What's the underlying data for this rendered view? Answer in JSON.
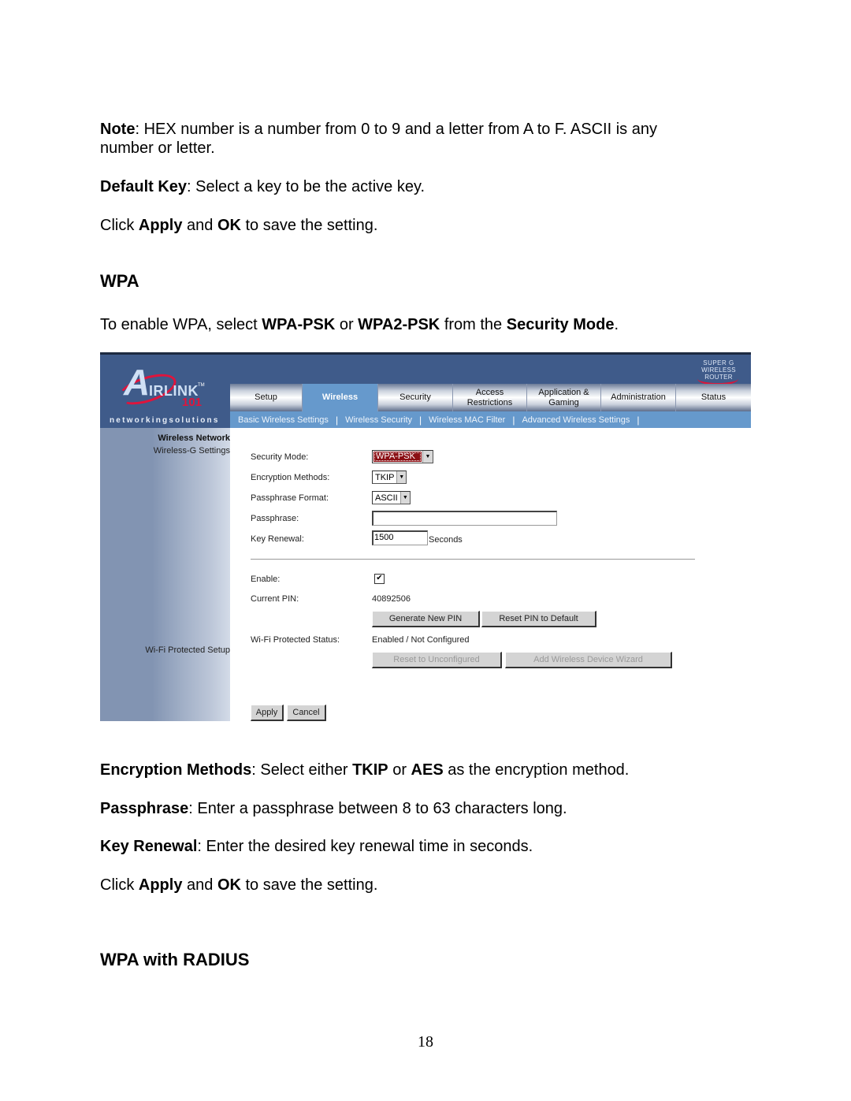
{
  "doc": {
    "note": {
      "bold": "Note",
      "rest": ": HEX number is a number from 0 to 9 and a letter from A to F. ASCII is any number or letter."
    },
    "default_key": {
      "bold": "Default Key",
      "rest": ": Select a key to be the active key."
    },
    "click_apply_1": {
      "pre": "Click ",
      "b1": "Apply",
      "mid": " and ",
      "b2": "OK",
      "post": " to save the setting."
    },
    "wpa_heading": "WPA",
    "wpa_intro": {
      "pre": "To enable WPA, select ",
      "b1": "WPA-PSK",
      "mid": " or ",
      "b2": "WPA2-PSK",
      "mid2": " from the ",
      "b3": "Security Mode",
      "post": "."
    },
    "encryption": {
      "bold": "Encryption Methods",
      "mid": ": Select either ",
      "b1": "TKIP",
      "mid2": " or ",
      "b2": "AES",
      "post": " as the encryption method."
    },
    "passphrase": {
      "bold": "Passphrase",
      "rest": ": Enter a passphrase between 8 to 63 characters long."
    },
    "key_renewal": {
      "bold": "Key Renewal",
      "rest": ": Enter the desired key renewal time in seconds."
    },
    "click_apply_2": {
      "pre": "Click ",
      "b1": "Apply",
      "mid": " and ",
      "b2": "OK",
      "post": " to save the setting."
    },
    "radius_heading": "WPA with RADIUS",
    "page_number": "18"
  },
  "router": {
    "logo": {
      "letter": "A",
      "brand": "IRLINK",
      "tm": "TM",
      "number": "101",
      "tagline": "networkingsolutions"
    },
    "badge": {
      "line1": "SUPER G",
      "line2": "WIRELESS ROUTER"
    },
    "tabs": [
      {
        "label": "Setup",
        "active": false
      },
      {
        "label": "Wireless",
        "active": true
      },
      {
        "label": "Security",
        "active": false
      },
      {
        "label": "Access Restrictions",
        "active": false
      },
      {
        "label": "Application & Gaming",
        "active": false
      },
      {
        "label": "Administration",
        "active": false
      },
      {
        "label": "Status",
        "active": false
      }
    ],
    "subnav": [
      "Basic Wireless Settings",
      "Wireless Security",
      "Wireless MAC Filter",
      "Advanced Wireless Settings"
    ],
    "sidebar": {
      "title": "Wireless Network",
      "sub": "Wireless-G Settings",
      "wps": "Wi-Fi Protected Setup"
    },
    "form": {
      "security_mode": {
        "label": "Security Mode:",
        "value": "WPA-PSK"
      },
      "encryption": {
        "label": "Encryption Methods:",
        "value": "TKIP"
      },
      "passphrase_format": {
        "label": "Passphrase Format:",
        "value": "ASCII"
      },
      "passphrase": {
        "label": "Passphrase:",
        "value": ""
      },
      "key_renewal": {
        "label": "Key Renewal:",
        "value": "1500",
        "unit": "Seconds"
      },
      "enable": {
        "label": "Enable:",
        "checked": true,
        "glyph": "✔"
      },
      "current_pin": {
        "label": "Current PIN:",
        "value": "40892506"
      },
      "generate_pin": "Generate New PIN",
      "reset_pin": "Reset PIN to Default",
      "wps_status": {
        "label": "Wi-Fi Protected Status:",
        "value": "Enabled / Not Configured"
      },
      "reset_unconfigured": "Reset to Unconfigured",
      "add_device_wizard": "Add Wireless Device Wizard",
      "apply": "Apply",
      "cancel": "Cancel",
      "dropdown_glyph": "▼"
    }
  }
}
